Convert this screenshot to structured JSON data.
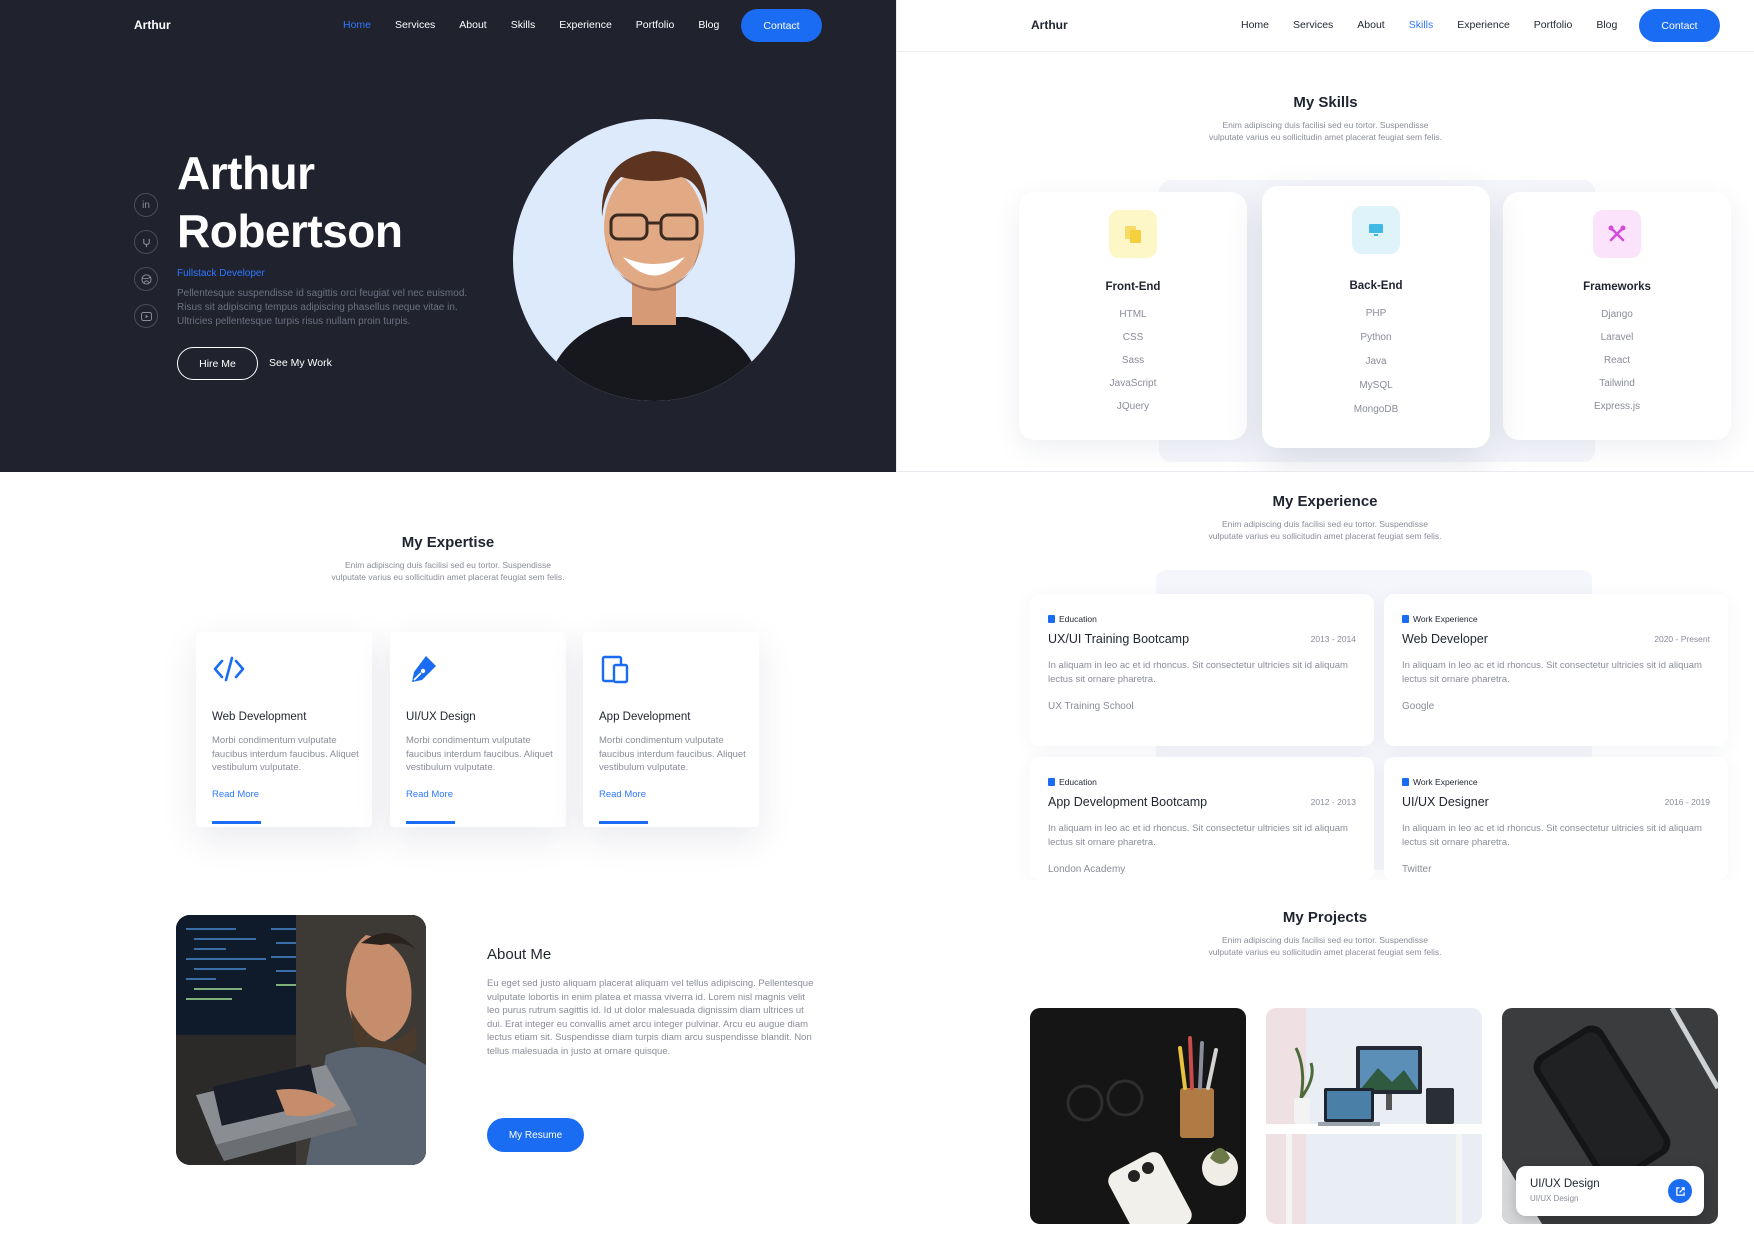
{
  "colors": {
    "accent": "#1a6cf2",
    "dark_bg": "#20222e",
    "muted": "#8a8d99"
  },
  "hero": {
    "logo": "Arthur",
    "nav": [
      "Home",
      "Services",
      "About",
      "Skills",
      "Experience",
      "Portfolio",
      "Blog"
    ],
    "active_nav": "Home",
    "contact_label": "Contact",
    "name_line1": "Arthur",
    "name_line2": "Robertson",
    "role": "Fullstack Developer",
    "description": "Pellentesque suspendisse id sagittis orci feugiat vel nec euismod. Risus sit adipiscing tempus adipiscing phasellus neque vitae in. Ultricies pellentesque turpis risus nullam proin turpis.",
    "hire_label": "Hire Me",
    "work_label": "See My Work",
    "social_icons": [
      "linkedin-icon",
      "github-icon",
      "dribbble-icon",
      "youtube-icon"
    ]
  },
  "skills": {
    "logo": "Arthur",
    "nav": [
      "Home",
      "Services",
      "About",
      "Skills",
      "Experience",
      "Portfolio",
      "Blog"
    ],
    "active_nav": "Skills",
    "contact_label": "Contact",
    "title": "My Skills",
    "subtitle_line1": "Enim adipiscing duis facilisi sed eu tortor. Suspendisse",
    "subtitle_line2": "vulputate varius eu sollicitudin amet placerat feugiat sem felis.",
    "cards": [
      {
        "title": "Front-End",
        "icon": "files-icon",
        "icon_bg": "#fdf6c6",
        "icon_color": "#f4d03f",
        "items": [
          "HTML",
          "CSS",
          "Sass",
          "JavaScript",
          "JQuery"
        ]
      },
      {
        "title": "Back-End",
        "icon": "monitor-icon",
        "icon_bg": "#dff3fb",
        "icon_color": "#3fb8e6",
        "items": [
          "PHP",
          "Python",
          "Java",
          "MySQL",
          "MongoDB"
        ]
      },
      {
        "title": "Frameworks",
        "icon": "tools-icon",
        "icon_bg": "#fbe3fb",
        "icon_color": "#d24bd8",
        "items": [
          "Django",
          "Laravel",
          "React",
          "Tailwind",
          "Express.js"
        ]
      }
    ]
  },
  "expertise": {
    "title": "My Expertise",
    "subtitle_line1": "Enim adipiscing duis facilisi sed eu tortor. Suspendisse",
    "subtitle_line2": "vulputate varius eu sollicitudin amet placerat feugiat sem felis.",
    "cards": [
      {
        "title": "Web Development",
        "icon": "code-icon",
        "description": "Morbi condimentum vulputate faucibus interdum faucibus. Aliquet vestibulum vulputate.",
        "link": "Read More"
      },
      {
        "title": "UI/UX Design",
        "icon": "pen-tool-icon",
        "description": "Morbi condimentum vulputate faucibus interdum faucibus. Aliquet vestibulum vulputate.",
        "link": "Read More"
      },
      {
        "title": "App Development",
        "icon": "devices-icon",
        "description": "Morbi condimentum vulputate faucibus interdum faucibus. Aliquet vestibulum vulputate.",
        "link": "Read More"
      }
    ]
  },
  "experience": {
    "title": "My Experience",
    "subtitle_line1": "Enim adipiscing duis facilisi sed eu tortor. Suspendisse",
    "subtitle_line2": "vulputate varius eu sollicitudin amet placerat feugiat sem felis.",
    "items": [
      {
        "category": "Education",
        "title": "UX/UI Training Bootcamp",
        "date": "2013 - 2014",
        "description": "In aliquam in leo ac et id rhoncus. Sit consectetur ultricies sit id aliquam lectus sit ornare pharetra.",
        "org": "UX Training School"
      },
      {
        "category": "Work Experience",
        "title": "Web Developer",
        "date": "2020 - Present",
        "description": "In aliquam in leo ac et id rhoncus. Sit consectetur ultricies sit id aliquam lectus sit ornare pharetra.",
        "org": "Google"
      },
      {
        "category": "Education",
        "title": "App Development Bootcamp",
        "date": "2012 - 2013",
        "description": "In aliquam in leo ac et id rhoncus. Sit consectetur ultricies sit id aliquam lectus sit ornare pharetra.",
        "org": "London Academy"
      },
      {
        "category": "Work Experience",
        "title": "UI/UX Designer",
        "date": "2016 - 2019",
        "description": "In aliquam in leo ac et id rhoncus. Sit consectetur ultricies sit id aliquam lectus sit ornare pharetra.",
        "org": "Twitter"
      }
    ]
  },
  "about": {
    "title": "About Me",
    "text": "Eu eget sed justo aliquam placerat aliquam vel tellus adipiscing. Pellentesque vulputate lobortis in enim platea et massa viverra id. Lorem nisl magnis velit leo purus rutrum sagittis id. Id ut dolor malesuada dignissim diam ultrices ut dui. Erat integer eu convallis amet arcu integer pulvinar. Arcu eu augue diam lectus etiam sit. Suspendisse diam turpis diam arcu suspendisse blandit. Non tellus malesuada in justo at ornare quisque.",
    "button": "My Resume"
  },
  "projects": {
    "title": "My Projects",
    "subtitle_line1": "Enim adipiscing duis facilisi sed eu tortor. Suspendisse",
    "subtitle_line2": "vulputate varius eu sollicitudin amet placerat feugiat sem felis.",
    "overlay_title": "UI/UX Design",
    "overlay_subtitle": "UI/UX Design"
  }
}
